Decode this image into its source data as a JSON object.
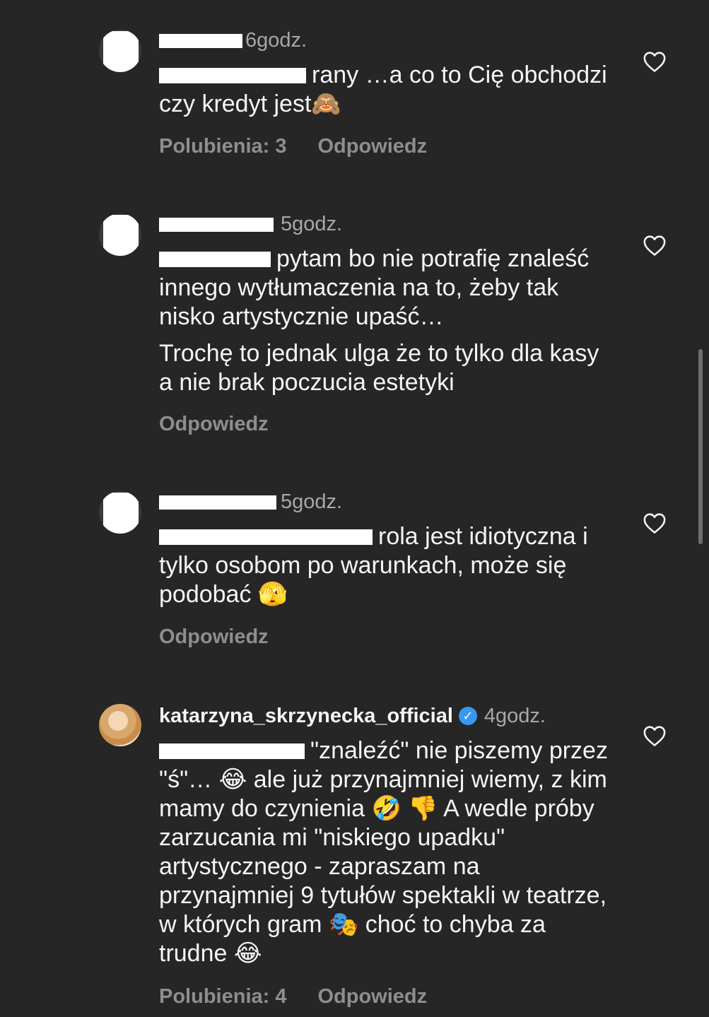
{
  "comments": [
    {
      "time": "6godz.",
      "body": [
        "rany …a co to Cię obchodzi czy kredyt jest🙈"
      ],
      "likes": "Polubienia: 3",
      "reply": "Odpowiedz"
    },
    {
      "time": "5godz.",
      "body": [
        "pytam bo nie potrafię znaleść innego wytłumaczenia na to, żeby tak nisko artystycznie upaść…",
        "Trochę to jednak ulga że to tylko dla kasy a nie brak poczucia estetyki"
      ],
      "reply": "Odpowiedz"
    },
    {
      "time": "5godz.",
      "body": [
        "rola jest idiotyczna i tylko osobom po warunkach, może się podobać 🫣"
      ],
      "reply": "Odpowiedz"
    },
    {
      "username": "katarzyna_skrzynecka_official",
      "verified": true,
      "time": "4godz.",
      "body": [
        "\"znaleźć\" nie piszemy przez \"ś\"… 😂 ale już przynajmniej wiemy, z kim mamy do czynienia 🤣 👎 A wedle próby zarzucania mi \"niskiego upadku\" artystycznego - zapraszam na przynajmniej 9 tytułów spektakli w teatrze, w których gram 🎭 choć to chyba za trudne 😂"
      ],
      "likes": "Polubienia: 4",
      "reply": "Odpowiedz"
    }
  ],
  "icons": {
    "heart": "heart-outline-icon",
    "verified": "verified-badge-icon"
  },
  "colors": {
    "background": "#262626",
    "text": "#f5f5f5",
    "secondary": "#a8a8a8",
    "action": "#8e8e8e",
    "verified": "#3897f0"
  }
}
